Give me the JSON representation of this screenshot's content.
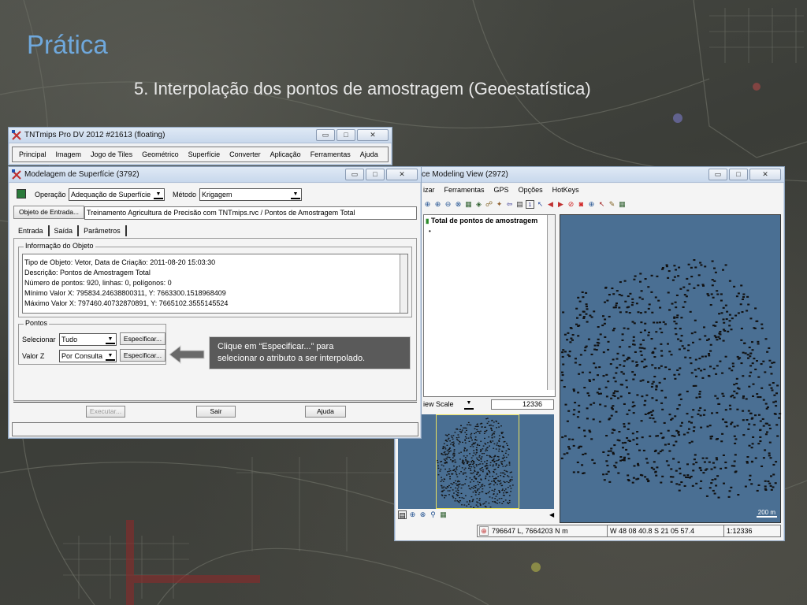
{
  "slide": {
    "title": "Prática",
    "subtitle": "5. Interpolação dos pontos de amostragem (Geoestatística)"
  },
  "menu_window": {
    "title": "TNTmips Pro DV 2012  #21613 (floating)",
    "menu_items": [
      "Principal",
      "Imagem",
      "Jogo de Tiles",
      "Geométrico",
      "Superfície",
      "Converter",
      "Aplicação",
      "Ferramentas",
      "Ajuda"
    ]
  },
  "model_window": {
    "title": "Modelagem de Superfície (3792)",
    "operation_label": "Operação",
    "operation_value": "Adequação de Superfície",
    "method_label": "Método",
    "method_value": "Krigagem",
    "input_button": "Objeto de Entrada...",
    "input_path": "Treinamento Agricultura de Precisão com TNTmips.rvc / Pontos de Amostragem Total",
    "tabs": [
      "Entrada",
      "Saída",
      "Parâmetros"
    ],
    "info_group_title": "Informação do Objeto",
    "info_lines": [
      "Tipo de Objeto: Vetor, Data de Criação: 2011-08-20 15:03:30",
      "Descrição: Pontos de Amostragem Total",
      "Número de pontos: 920, linhas: 0, polígonos: 0",
      "Mínimo Valor X: 795834.24638800311, Y: 7663300.1518968409",
      "Máximo Valor X: 797460.40732870891, Y: 7665102.3555145524"
    ],
    "points_group_title": "Pontos",
    "select_label": "Selecionar",
    "select_value": "Tudo",
    "zvalue_label": "Valor Z",
    "zvalue_value": "Por Consulta",
    "specify_label": "Especificar...",
    "execute_label": "Executar...",
    "exit_label": "Sair",
    "help_label": "Ajuda"
  },
  "view_window": {
    "title": "ce Modeling View (2972)",
    "menu_items": [
      "izar",
      "Ferramentas",
      "GPS",
      "Opções",
      "HotKeys"
    ],
    "layer_name": "Total de pontos de amostragem",
    "scale_label": "iew Scale",
    "scale_value": "12336",
    "scalebar_label": "200 m",
    "coords": "796647 L, 7664203 N m",
    "geo_coords": "W 48 08 40.8  S 21 05 57.4",
    "ratio": "1:12336"
  },
  "callout": {
    "text_line1": "Clique em “Especificar...”  para",
    "text_line2": "selecionar o atributo a ser interpolado."
  },
  "colors": {
    "map_background": "#4a6f93",
    "point_color": "#111111",
    "title_color": "#6fa8dc",
    "callout_bg": "#5a5a5a"
  }
}
